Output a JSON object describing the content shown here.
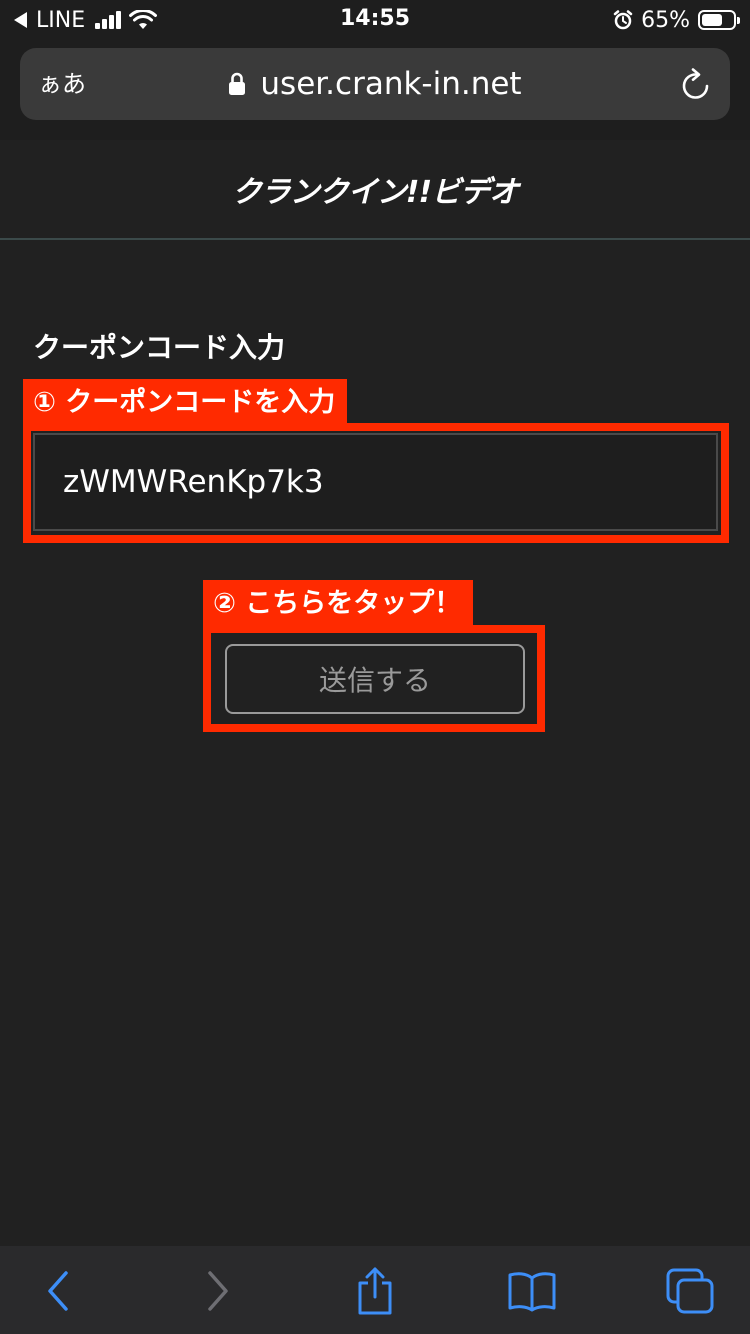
{
  "status_bar": {
    "carrier": "LINE",
    "time": "14:55",
    "battery_percent_label": "65%",
    "battery_level": 0.65
  },
  "browser": {
    "aa_label": "ぁあ",
    "url": "user.crank-in.net"
  },
  "site": {
    "logo_text": "クランクイン!!ビデオ"
  },
  "form": {
    "section_title": "クーポンコード入力",
    "code_value": "zWMWRenKp7k3",
    "submit_label": "送信する"
  },
  "callouts": {
    "step1": "① クーポンコードを入力",
    "step2": "② こちらをタップ！"
  },
  "colors": {
    "background": "#212121",
    "callout_red": "#ff2a00",
    "toolbar_blue": "#3d8ef7",
    "disabled_gray": "#6e6e73"
  },
  "icons": {
    "back": "chevron-left-icon",
    "forward": "chevron-right-icon",
    "share": "share-icon",
    "bookmarks": "book-icon",
    "tabs": "tabs-icon"
  }
}
